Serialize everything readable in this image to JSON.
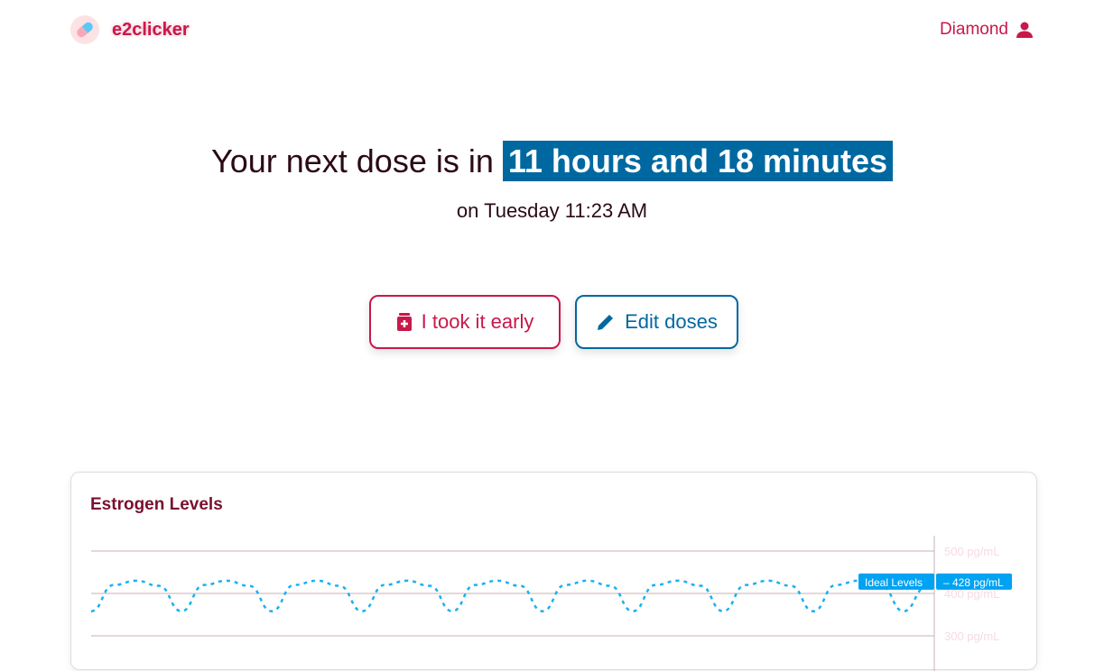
{
  "header": {
    "app_name": "e2clicker",
    "user_name": "Diamond",
    "logo_icon": "pill-icon",
    "user_icon": "user-icon"
  },
  "main": {
    "headline_prefix": "Your next dose is in",
    "headline_time": "11 hours and 18 minutes",
    "subline": "on Tuesday 11:23 AM",
    "buttons": [
      {
        "label": "I took it early",
        "icon": "medicine-bottle-icon",
        "color": "#c9184a"
      },
      {
        "label": "Edit doses",
        "icon": "pencil-icon",
        "color": "#0068a0"
      }
    ]
  },
  "chart_card": {
    "title": "Estrogen Levels"
  },
  "chart_data": {
    "type": "line",
    "title": "Estrogen Levels",
    "y_ticks": [
      "500 pg/mL",
      "400 pg/mL",
      "300 pg/mL"
    ],
    "ylim": [
      300,
      500
    ],
    "series": [
      {
        "style": "dashed",
        "color": "#1ab0f0",
        "values": [
          358,
          420,
          430,
          418,
          358,
          420,
          430,
          418,
          358,
          420,
          430,
          418,
          358,
          420,
          430,
          418,
          358,
          420,
          430,
          418,
          358,
          420,
          430,
          418,
          358,
          420,
          430,
          418,
          358,
          420,
          430,
          418,
          358,
          420,
          430,
          418,
          358,
          415
        ]
      }
    ],
    "annotation": {
      "label": "Ideal Levels",
      "value_label": "428 pg/mL",
      "value": 428,
      "color": "#00a2f2"
    }
  }
}
